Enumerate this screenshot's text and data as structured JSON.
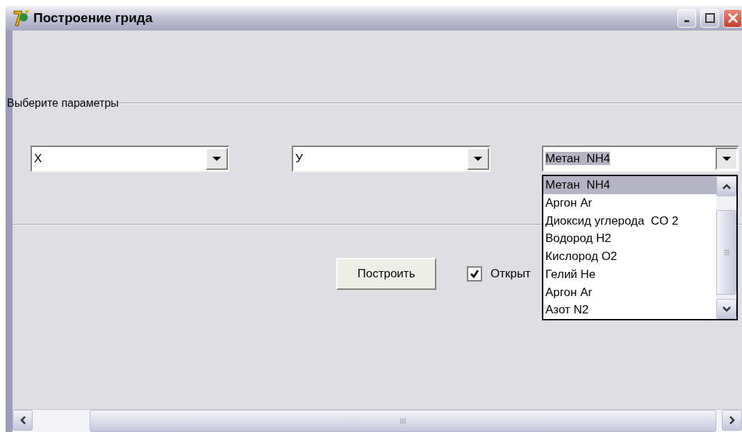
{
  "window": {
    "title": "Построение грида"
  },
  "group": {
    "label": "Выберите параметры"
  },
  "combos": [
    {
      "value": "X",
      "highlighted": false,
      "open": false
    },
    {
      "value": "У",
      "highlighted": false,
      "open": false
    },
    {
      "value": "Метан  NH4",
      "highlighted": true,
      "open": true
    }
  ],
  "dropdown": {
    "items": [
      {
        "label": "Метан  NH4",
        "selected": true
      },
      {
        "label": "Аргон Ar",
        "selected": false
      },
      {
        "label": "Диоксид углерода  CO 2",
        "selected": false
      },
      {
        "label": "Водород H2",
        "selected": false
      },
      {
        "label": "Кислород O2",
        "selected": false
      },
      {
        "label": "Гелий He",
        "selected": false
      },
      {
        "label": "Аргон Ar",
        "selected": false
      },
      {
        "label": "Азот N2",
        "selected": false
      }
    ]
  },
  "build_button": {
    "label": "Построить"
  },
  "checkbox": {
    "label": "Открыт",
    "checked": true
  }
}
